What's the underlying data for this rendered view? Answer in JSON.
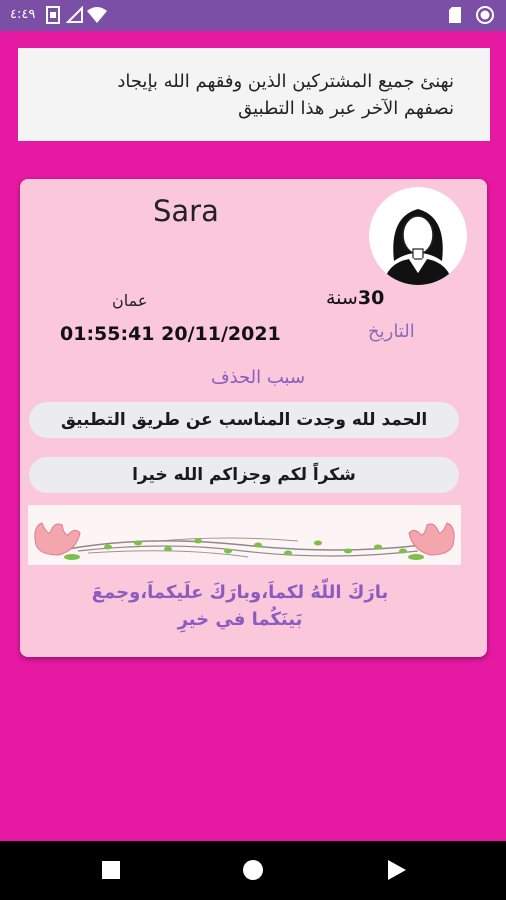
{
  "status_bar": {
    "time": "٤:٤٩",
    "icons": [
      "photo-icon",
      "notification-icon",
      "wifi-icon",
      "sim-card-icon",
      "no-sim-icon"
    ]
  },
  "banner": {
    "line1": "نهنئ جميع المشتركين الذين وفقهم الله بإيجاد",
    "line2": "نصفهم الآخر عبر هذا التطبيق"
  },
  "card": {
    "name": "Sara",
    "age_number": "30",
    "age_unit": "سنة",
    "city": "عمان",
    "date_label": "التاريخ",
    "datetime": "01:55:41 20/11/2021",
    "reason_label": "سبب الحذف",
    "reason_text": "الحمد لله وجدت المناسب عن طريق التطبيق",
    "thanks_text": "شكراً لكم وجزاكم الله خيرا",
    "blessing_line1": "بارَكَ اللّهُ لكماَ،وبارَكَ علَيكماَ،وجمعَ",
    "blessing_line2": "بَينَكُما في خيرِ"
  },
  "colors": {
    "background": "#e619a3",
    "status_bar": "#7b4fa6",
    "card": "#fbc8db",
    "accent_text": "#8b5cc0"
  },
  "nav_bar": {
    "icons": [
      "recents-square-icon",
      "home-circle-icon",
      "back-triangle-icon"
    ]
  }
}
